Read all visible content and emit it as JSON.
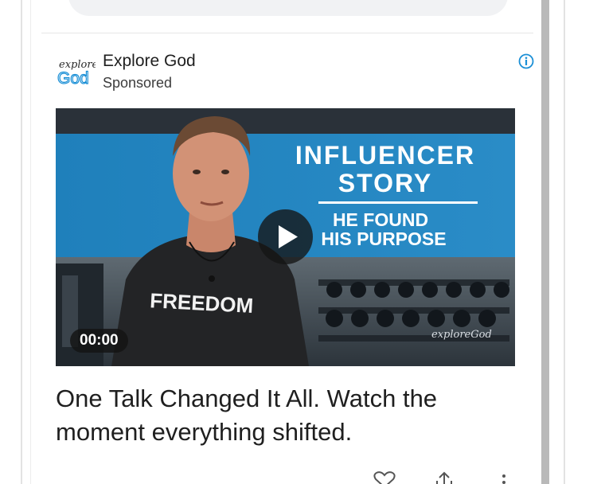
{
  "ad": {
    "advertiser_name": "Explore God",
    "sponsored_label": "Sponsored",
    "logo_text_top": "explore",
    "logo_text_bottom": "God",
    "video": {
      "heading_line1": "INFLUENCER",
      "heading_line2": "STORY",
      "subheading_line1": "HE FOUND",
      "subheading_line2": "HIS PURPOSE",
      "shirt_text": "FREEDOM",
      "watermark": "exploreGod",
      "timestamp": "00:00"
    },
    "headline": "One Talk Changed It All. Watch the moment everything shifted."
  },
  "icons": {
    "info": "info-icon",
    "play": "play-icon",
    "like": "heart-icon",
    "share": "share-icon",
    "more": "more-vertical-icon"
  },
  "colors": {
    "accent_blue": "#1a8fd6",
    "banner_blue": "#1f7fb8",
    "text_primary": "#1f1f1f"
  }
}
